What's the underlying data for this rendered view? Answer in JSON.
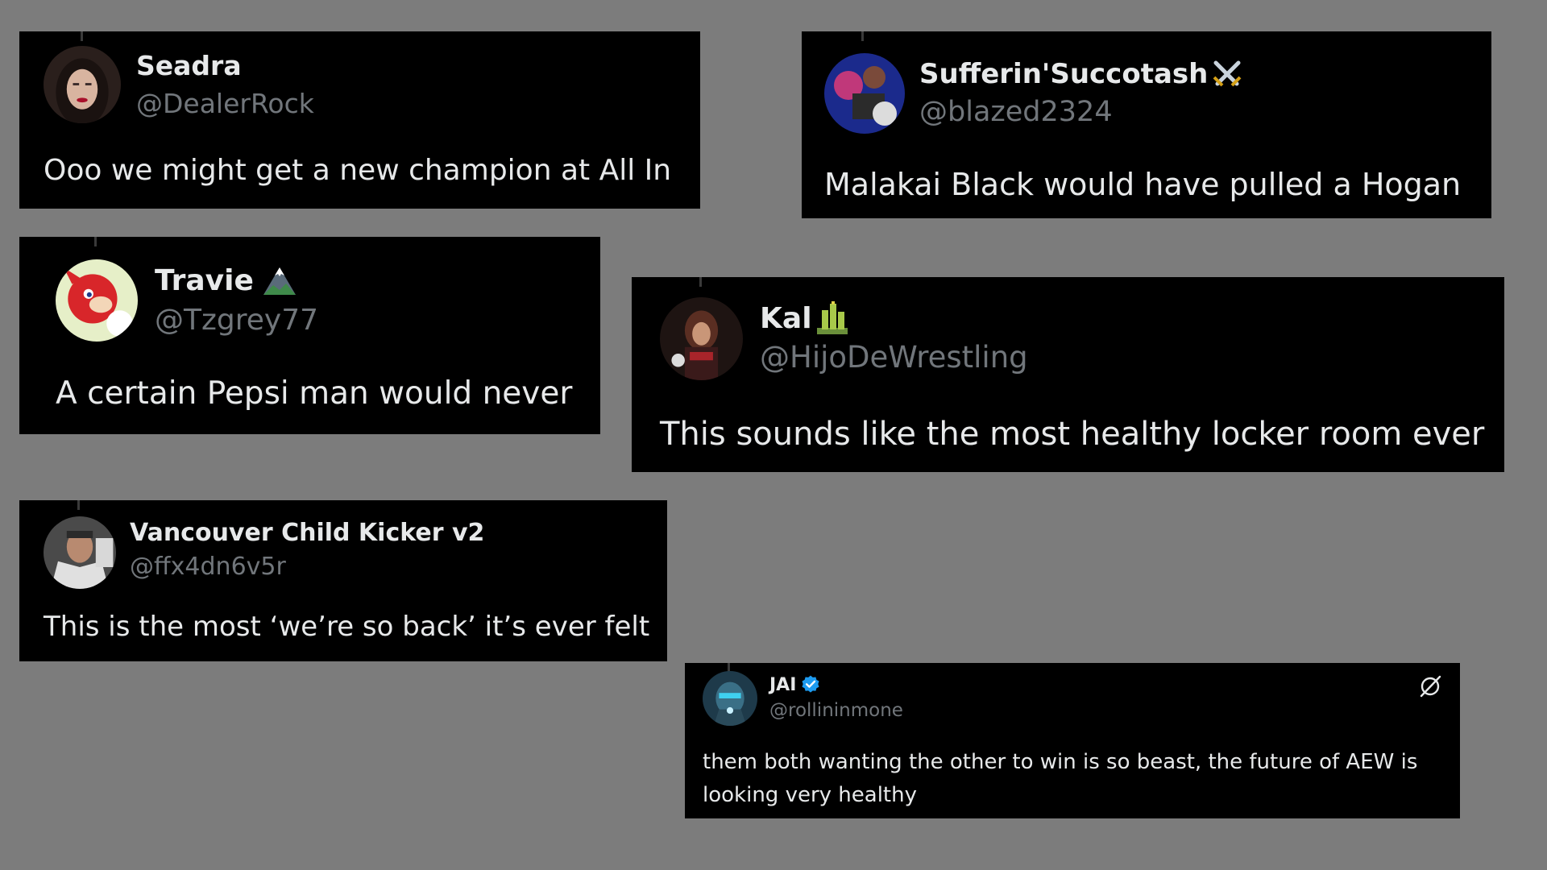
{
  "tweets": [
    {
      "name": "Seadra",
      "handle": "@DealerRock",
      "text": "Ooo we might get a new champion at All In"
    },
    {
      "name": "Sufferin'Succotash",
      "name_emoji": "crossed-swords-icon",
      "handle": "@blazed2324",
      "text": "Malakai Black would have pulled a Hogan"
    },
    {
      "name": "Travie",
      "name_emoji": "mountain-icon",
      "handle": "@Tzgrey77",
      "text": "A certain Pepsi man would never"
    },
    {
      "name": "Kal",
      "name_emoji": "tower-icon",
      "handle": "@HijoDeWrestling",
      "text": "This sounds like the most healthy locker room ever"
    },
    {
      "name": "Vancouver Child Kicker v2",
      "handle": "@ffx4dn6v5r",
      "text": "This is the most ‘we’re so back’ it’s ever felt"
    },
    {
      "name": "JAI",
      "verified": true,
      "handle": "@rollininmone",
      "text": "them both wanting the other to win is so beast, the future of AEW is looking very healthy",
      "action_icon": "grok-icon"
    }
  ],
  "colors": {
    "page_background": "#7c7c7c",
    "card_background": "#000000",
    "name_text": "#e7e9ea",
    "handle_text": "#71767b",
    "verified_badge": "#1d9bf0"
  }
}
